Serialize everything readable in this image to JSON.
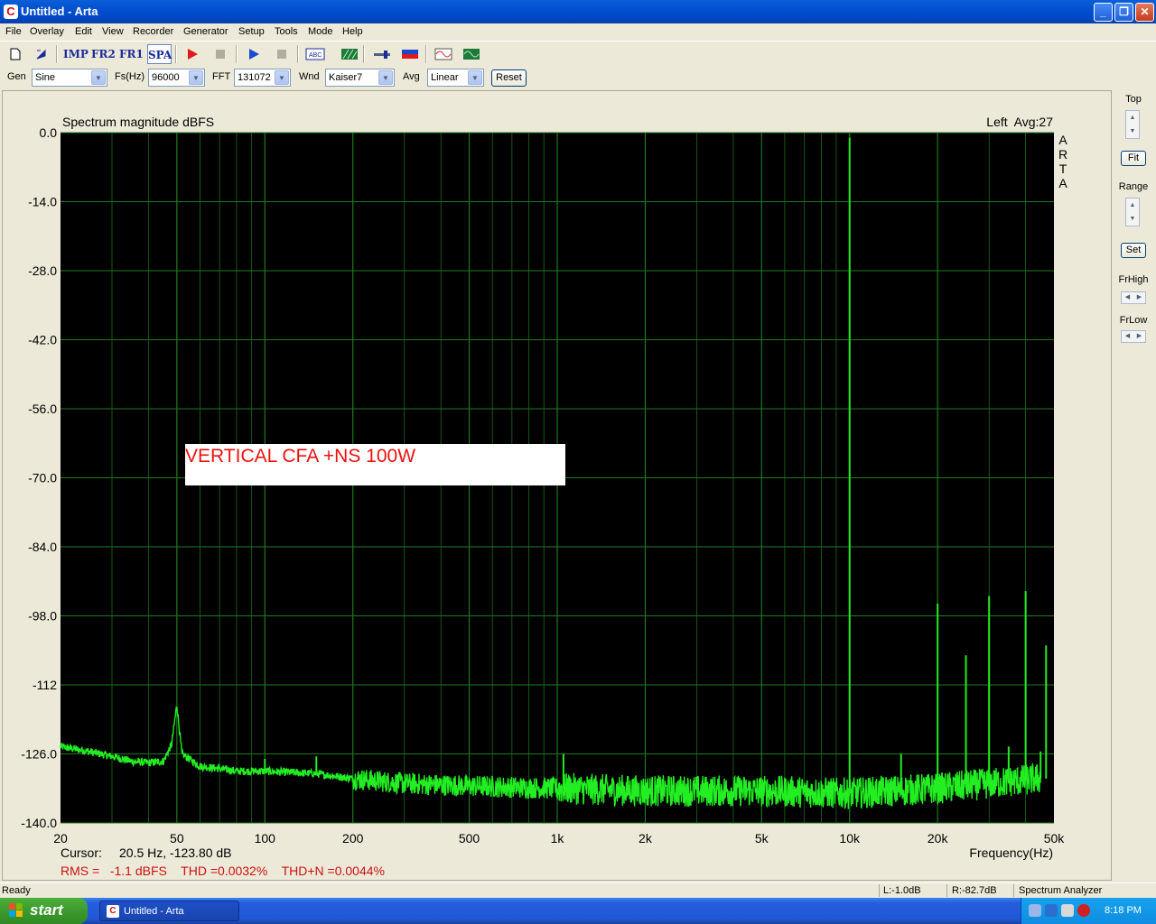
{
  "window": {
    "title": "Untitled - Arta",
    "icon": "arta-app-icon"
  },
  "menu": [
    "File",
    "Overlay",
    "Edit",
    "View",
    "Recorder",
    "Generator",
    "Setup",
    "Tools",
    "Mode",
    "Help"
  ],
  "toolbar": {
    "imp_label": "IMP",
    "fr2_label": "FR2",
    "fr1_label": "FR1",
    "spa_label": "SPA"
  },
  "controls": {
    "gen_label": "Gen",
    "gen_value": "Sine",
    "fs_label": "Fs(Hz)",
    "fs_value": "96000",
    "fft_label": "FFT",
    "fft_value": "131072",
    "wnd_label": "Wnd",
    "wnd_value": "Kaiser7",
    "avg_label": "Avg",
    "avg_value": "Linear",
    "reset_label": "Reset"
  },
  "plot": {
    "title": "Spectrum magnitude dBFS",
    "channel_info": "Left  Avg:27",
    "vertical_brand": "ARTA",
    "annotation": "VERTICAL CFA +NS 100W",
    "cursor_label": "Cursor:",
    "cursor_value": "20.5 Hz, -123.80 dB",
    "freq_label": "Frequency(Hz)",
    "stats": "RMS =   -1.1 dBFS    THD =0.0032%    THD+N =0.0044%",
    "background": "#000000",
    "grid_color": "#1f7a1f",
    "trace_color": "#22ee22",
    "annotation_color": "#ee1111"
  },
  "chart_data": {
    "type": "line",
    "title": "Spectrum magnitude dBFS",
    "xlabel": "Frequency(Hz)",
    "ylabel": "",
    "x_scale": "log",
    "xlim": [
      20,
      50000
    ],
    "ylim": [
      -140,
      0
    ],
    "y_ticks": [
      "0.0",
      "-14.0",
      "-28.0",
      "-42.0",
      "-56.0",
      "-70.0",
      "-84.0",
      "-98.0",
      "-112",
      "-126.0",
      "-140.0"
    ],
    "x_ticks": [
      "20",
      "50",
      "100",
      "200",
      "500",
      "1k",
      "2k",
      "5k",
      "10k",
      "20k",
      "50k"
    ],
    "x_tick_values": [
      20,
      50,
      100,
      200,
      500,
      1000,
      2000,
      5000,
      10000,
      20000,
      50000
    ],
    "grid": true,
    "series": [
      {
        "values": [
          [
            20,
            -124.5
          ],
          [
            25,
            -125.5
          ],
          [
            30,
            -126.5
          ],
          [
            35,
            -127.5
          ],
          [
            40,
            -127.8
          ],
          [
            45,
            -127.5
          ],
          [
            48,
            -124
          ],
          [
            50,
            -116
          ],
          [
            52,
            -126
          ],
          [
            60,
            -128.5
          ],
          [
            70,
            -129
          ],
          [
            80,
            -129.5
          ],
          [
            100,
            -129.5
          ],
          [
            150,
            -130
          ],
          [
            200,
            -131
          ],
          [
            300,
            -132
          ],
          [
            500,
            -132.5
          ],
          [
            1000,
            -133
          ],
          [
            2000,
            -133.5
          ],
          [
            5000,
            -133.5
          ],
          [
            10000,
            -134
          ],
          [
            20000,
            -133
          ],
          [
            30000,
            -132
          ],
          [
            45000,
            -131
          ]
        ]
      }
    ],
    "spikes": [
      [
        10000,
        -1.0
      ],
      [
        20000,
        -95.5
      ],
      [
        25000,
        -106
      ],
      [
        30000,
        -94
      ],
      [
        40000,
        -93
      ],
      [
        47000,
        -104
      ],
      [
        35000,
        -124.5
      ],
      [
        45000,
        -125.5
      ],
      [
        15000,
        -126
      ],
      [
        150,
        -126.5
      ],
      [
        1050,
        -126
      ],
      [
        100,
        -127
      ]
    ]
  },
  "right_panel": {
    "top_label": "Top",
    "fit_label": "Fit",
    "range_label": "Range",
    "set_label": "Set",
    "frhigh_label": "FrHigh",
    "frlow_label": "FrLow"
  },
  "status": {
    "ready": "Ready",
    "left_level": "L:-1.0dB",
    "right_level": "R:-82.7dB",
    "mode": "Spectrum Analyzer"
  },
  "taskbar": {
    "start_label": "start",
    "task_label": "Untitled - Arta",
    "clock": "8:18 PM"
  }
}
